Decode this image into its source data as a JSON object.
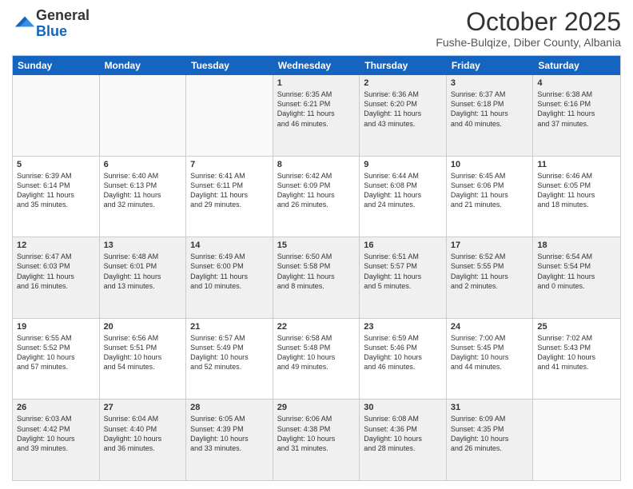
{
  "logo": {
    "general": "General",
    "blue": "Blue"
  },
  "header": {
    "month": "October 2025",
    "location": "Fushe-Bulqize, Diber County, Albania"
  },
  "weekdays": [
    "Sunday",
    "Monday",
    "Tuesday",
    "Wednesday",
    "Thursday",
    "Friday",
    "Saturday"
  ],
  "rows": [
    [
      {
        "day": "",
        "info": ""
      },
      {
        "day": "",
        "info": ""
      },
      {
        "day": "",
        "info": ""
      },
      {
        "day": "1",
        "info": "Sunrise: 6:35 AM\nSunset: 6:21 PM\nDaylight: 11 hours\nand 46 minutes."
      },
      {
        "day": "2",
        "info": "Sunrise: 6:36 AM\nSunset: 6:20 PM\nDaylight: 11 hours\nand 43 minutes."
      },
      {
        "day": "3",
        "info": "Sunrise: 6:37 AM\nSunset: 6:18 PM\nDaylight: 11 hours\nand 40 minutes."
      },
      {
        "day": "4",
        "info": "Sunrise: 6:38 AM\nSunset: 6:16 PM\nDaylight: 11 hours\nand 37 minutes."
      }
    ],
    [
      {
        "day": "5",
        "info": "Sunrise: 6:39 AM\nSunset: 6:14 PM\nDaylight: 11 hours\nand 35 minutes."
      },
      {
        "day": "6",
        "info": "Sunrise: 6:40 AM\nSunset: 6:13 PM\nDaylight: 11 hours\nand 32 minutes."
      },
      {
        "day": "7",
        "info": "Sunrise: 6:41 AM\nSunset: 6:11 PM\nDaylight: 11 hours\nand 29 minutes."
      },
      {
        "day": "8",
        "info": "Sunrise: 6:42 AM\nSunset: 6:09 PM\nDaylight: 11 hours\nand 26 minutes."
      },
      {
        "day": "9",
        "info": "Sunrise: 6:44 AM\nSunset: 6:08 PM\nDaylight: 11 hours\nand 24 minutes."
      },
      {
        "day": "10",
        "info": "Sunrise: 6:45 AM\nSunset: 6:06 PM\nDaylight: 11 hours\nand 21 minutes."
      },
      {
        "day": "11",
        "info": "Sunrise: 6:46 AM\nSunset: 6:05 PM\nDaylight: 11 hours\nand 18 minutes."
      }
    ],
    [
      {
        "day": "12",
        "info": "Sunrise: 6:47 AM\nSunset: 6:03 PM\nDaylight: 11 hours\nand 16 minutes."
      },
      {
        "day": "13",
        "info": "Sunrise: 6:48 AM\nSunset: 6:01 PM\nDaylight: 11 hours\nand 13 minutes."
      },
      {
        "day": "14",
        "info": "Sunrise: 6:49 AM\nSunset: 6:00 PM\nDaylight: 11 hours\nand 10 minutes."
      },
      {
        "day": "15",
        "info": "Sunrise: 6:50 AM\nSunset: 5:58 PM\nDaylight: 11 hours\nand 8 minutes."
      },
      {
        "day": "16",
        "info": "Sunrise: 6:51 AM\nSunset: 5:57 PM\nDaylight: 11 hours\nand 5 minutes."
      },
      {
        "day": "17",
        "info": "Sunrise: 6:52 AM\nSunset: 5:55 PM\nDaylight: 11 hours\nand 2 minutes."
      },
      {
        "day": "18",
        "info": "Sunrise: 6:54 AM\nSunset: 5:54 PM\nDaylight: 11 hours\nand 0 minutes."
      }
    ],
    [
      {
        "day": "19",
        "info": "Sunrise: 6:55 AM\nSunset: 5:52 PM\nDaylight: 10 hours\nand 57 minutes."
      },
      {
        "day": "20",
        "info": "Sunrise: 6:56 AM\nSunset: 5:51 PM\nDaylight: 10 hours\nand 54 minutes."
      },
      {
        "day": "21",
        "info": "Sunrise: 6:57 AM\nSunset: 5:49 PM\nDaylight: 10 hours\nand 52 minutes."
      },
      {
        "day": "22",
        "info": "Sunrise: 6:58 AM\nSunset: 5:48 PM\nDaylight: 10 hours\nand 49 minutes."
      },
      {
        "day": "23",
        "info": "Sunrise: 6:59 AM\nSunset: 5:46 PM\nDaylight: 10 hours\nand 46 minutes."
      },
      {
        "day": "24",
        "info": "Sunrise: 7:00 AM\nSunset: 5:45 PM\nDaylight: 10 hours\nand 44 minutes."
      },
      {
        "day": "25",
        "info": "Sunrise: 7:02 AM\nSunset: 5:43 PM\nDaylight: 10 hours\nand 41 minutes."
      }
    ],
    [
      {
        "day": "26",
        "info": "Sunrise: 6:03 AM\nSunset: 4:42 PM\nDaylight: 10 hours\nand 39 minutes."
      },
      {
        "day": "27",
        "info": "Sunrise: 6:04 AM\nSunset: 4:40 PM\nDaylight: 10 hours\nand 36 minutes."
      },
      {
        "day": "28",
        "info": "Sunrise: 6:05 AM\nSunset: 4:39 PM\nDaylight: 10 hours\nand 33 minutes."
      },
      {
        "day": "29",
        "info": "Sunrise: 6:06 AM\nSunset: 4:38 PM\nDaylight: 10 hours\nand 31 minutes."
      },
      {
        "day": "30",
        "info": "Sunrise: 6:08 AM\nSunset: 4:36 PM\nDaylight: 10 hours\nand 28 minutes."
      },
      {
        "day": "31",
        "info": "Sunrise: 6:09 AM\nSunset: 4:35 PM\nDaylight: 10 hours\nand 26 minutes."
      },
      {
        "day": "",
        "info": ""
      }
    ]
  ]
}
